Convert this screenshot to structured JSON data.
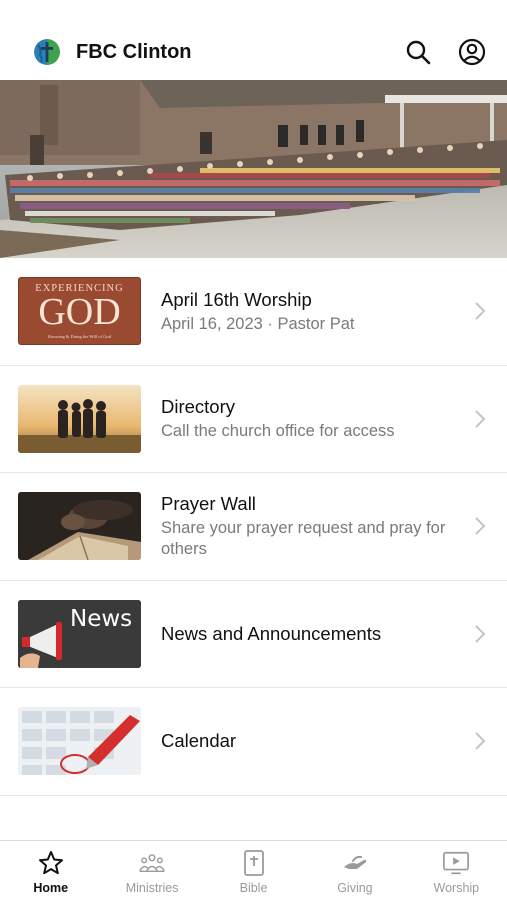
{
  "header": {
    "title": "FBC Clinton",
    "logo_icon": "globe-cross-logo",
    "search_icon": "search-icon",
    "profile_icon": "account-circle-icon"
  },
  "hero": {
    "image": "church-congregation-group-photo"
  },
  "list": [
    {
      "title": "April 16th Worship",
      "subtitle": "April 16, 2023 · Pastor Pat",
      "thumb": "experiencing-god-artwork",
      "thumb_text": {
        "top": "EXPERIENCING",
        "main": "GOD",
        "bottom": "Knowing & Doing the Will of God"
      }
    },
    {
      "title": "Directory",
      "subtitle": "Call the church office for access",
      "thumb": "group-silhouette-sunset-photo"
    },
    {
      "title": "Prayer Wall",
      "subtitle": "Share your prayer request and pray for others",
      "thumb": "praying-hands-bible-photo"
    },
    {
      "title": "News and Announcements",
      "subtitle": "",
      "thumb": "megaphone-news-graphic",
      "thumb_text": {
        "main": "News"
      }
    },
    {
      "title": "Calendar",
      "subtitle": "",
      "thumb": "calendar-pen-photo"
    }
  ],
  "tabs": [
    {
      "label": "Home",
      "icon": "star-icon",
      "active": true
    },
    {
      "label": "Ministries",
      "icon": "people-group-icon",
      "active": false
    },
    {
      "label": "Bible",
      "icon": "bible-icon",
      "active": false
    },
    {
      "label": "Giving",
      "icon": "giving-hand-icon",
      "active": false
    },
    {
      "label": "Worship",
      "icon": "play-screen-icon",
      "active": false
    }
  ],
  "colors": {
    "active_tab": "#111111",
    "inactive_tab": "#9a9a9a",
    "subtitle": "#7a7a7a",
    "divider": "#e6e6e6"
  }
}
